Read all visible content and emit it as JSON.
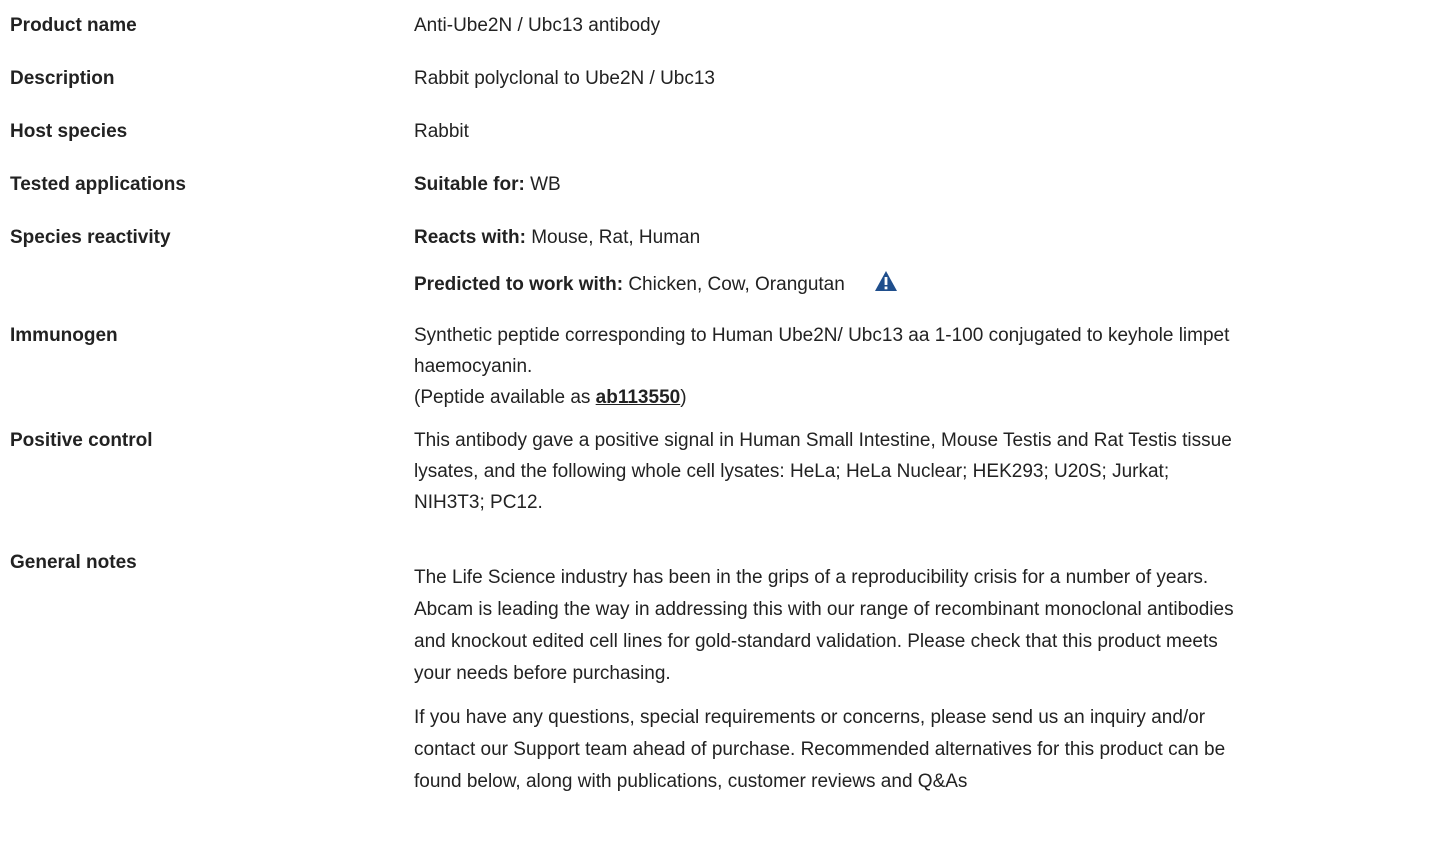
{
  "rows": {
    "product_name": {
      "label": "Product name",
      "value": "Anti-Ube2N / Ubc13 antibody"
    },
    "description": {
      "label": "Description",
      "value": "Rabbit polyclonal to Ube2N / Ubc13"
    },
    "host_species": {
      "label": "Host species",
      "value": "Rabbit"
    },
    "tested_applications": {
      "label": "Tested applications",
      "prefix": "Suitable for:",
      "value": "WB"
    },
    "species_reactivity": {
      "label": "Species reactivity",
      "reacts_prefix": "Reacts with:",
      "reacts_value": "Mouse, Rat, Human",
      "predicted_prefix": "Predicted to work with:",
      "predicted_value": "Chicken, Cow, Orangutan"
    },
    "immunogen": {
      "label": "Immunogen",
      "line1": "Synthetic peptide corresponding to Human Ube2N/ Ubc13 aa 1-100 conjugated to keyhole limpet",
      "line2": "haemocyanin.",
      "peptide_prefix": "(Peptide available as ",
      "peptide_link": "ab113550",
      "peptide_suffix": ")"
    },
    "positive_control": {
      "label": "Positive control",
      "line1": "This antibody gave a positive signal in Human Small Intestine, Mouse Testis and Rat Testis tissue",
      "line2": "lysates, and the following whole cell lysates: HeLa; HeLa Nuclear; HEK293; U20S; Jurkat;",
      "line3": "NIH3T3; PC12."
    },
    "general_notes": {
      "label": "General notes",
      "p1_line1": "The Life Science industry has been in the grips of a reproducibility crisis for a number of years.",
      "p1_line2": "Abcam is leading the way in addressing this with our range of recombinant monoclonal antibodies",
      "p1_line3": "and knockout edited cell lines for gold-standard validation. Please check that this product meets",
      "p1_line4": "your needs before purchasing.",
      "p2_line1": "If you have any questions, special requirements or concerns, please send us an inquiry and/or",
      "p2_line2": "contact our Support team ahead of purchase. Recommended alternatives for this product can be",
      "p2_line3": "found below, along with publications, customer reviews and Q&As"
    }
  },
  "icons": {
    "predicted_warning": "warning-triangle-icon"
  },
  "colors": {
    "warning_icon": "#1f4e8c",
    "text": "#222222"
  }
}
